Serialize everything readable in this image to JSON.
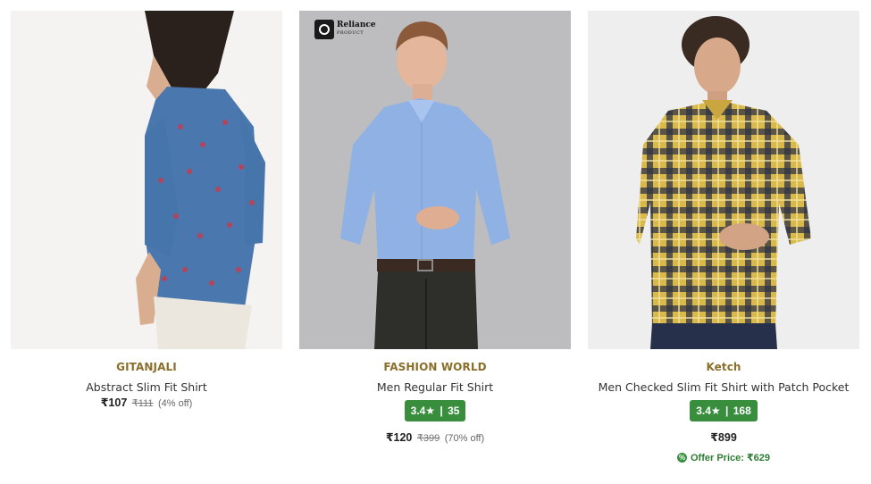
{
  "products": [
    {
      "brand": "GITANJALI",
      "title": "Abstract Slim Fit Shirt",
      "price": "₹107",
      "mrp": "₹111",
      "discount": "(4% off)"
    },
    {
      "brand": "FASHION WORLD",
      "title": "Men Regular Fit Shirt",
      "badge": {
        "name": "Reliance",
        "sub": "PRODUCT"
      },
      "rating": "3.4",
      "star": "★",
      "separator": "|",
      "rating_count": "35",
      "price": "₹120",
      "mrp": "₹399",
      "discount": "(70% off)"
    },
    {
      "brand": "Ketch",
      "title": "Men Checked Slim Fit Shirt with Patch Pocket",
      "rating": "3.4",
      "star": "★",
      "separator": "|",
      "rating_count": "168",
      "price": "₹899",
      "offer_price": "Offer Price: ₹629"
    }
  ],
  "colors": {
    "brand_text": "#8a6f2a",
    "rating_badge": "#388e3c",
    "offer_text": "#2e7d32"
  }
}
